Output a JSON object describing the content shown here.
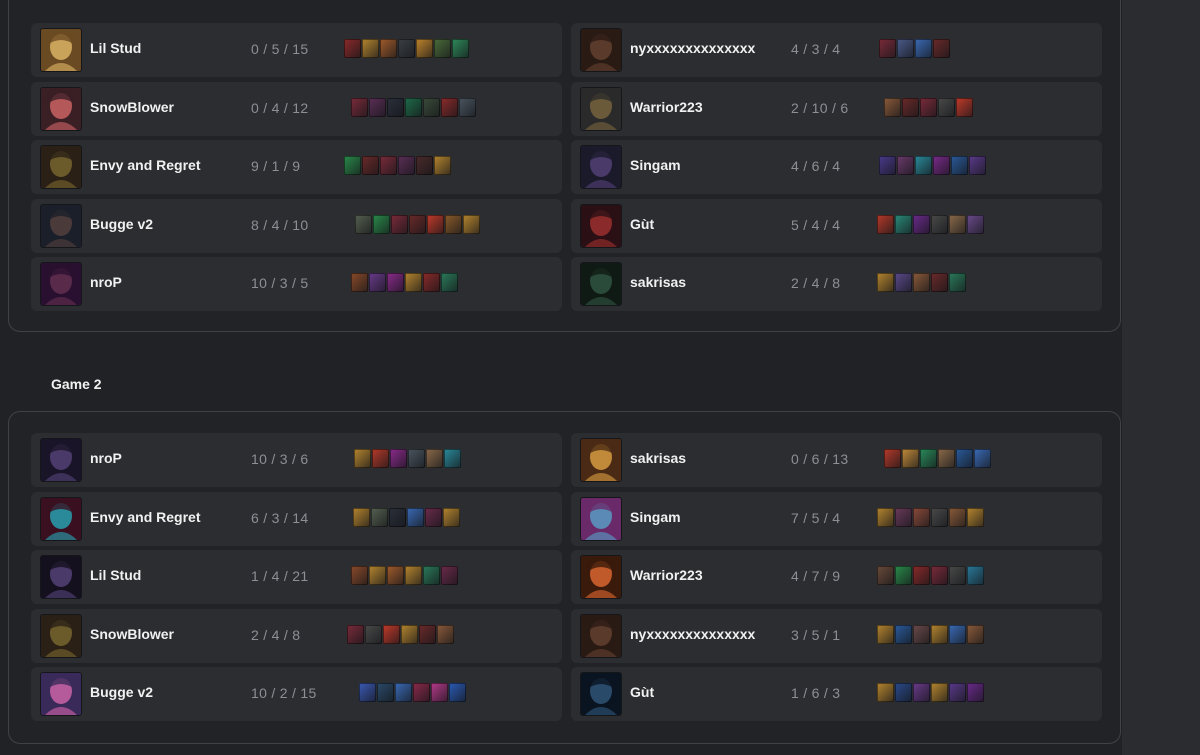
{
  "game2_label": "Game 2",
  "games": [
    {
      "left": [
        {
          "name": "Lil Stud",
          "kda": "0 / 5 / 15",
          "avatar": [
            "#caa35a",
            "#6a4a22"
          ],
          "items": [
            "#8b2a2a",
            "#b5852f",
            "#a05b2c",
            "#3b3f44",
            "#c0852c",
            "#4a6b3a",
            "#2e8a5a"
          ]
        },
        {
          "name": "SnowBlower",
          "kda": "0 / 4 / 12",
          "avatar": [
            "#b5585a",
            "#3a1f24"
          ],
          "items": [
            "#7a2b3a",
            "#5a2e55",
            "#2a2f3a",
            "#1f6b4a",
            "#3a4a3a",
            "#8a2b2b",
            "#4a5560"
          ]
        },
        {
          "name": "Envy and Regret",
          "kda": "9 / 1 / 9",
          "avatar": [
            "#6b5a2a",
            "#2a2016"
          ],
          "items": [
            "#2a8a4a",
            "#6a2a2a",
            "#7a2b3a",
            "#5a2e55",
            "#4a2a2a",
            "#b5852f"
          ]
        },
        {
          "name": "Bugge v2",
          "kda": "8 / 4 / 10",
          "avatar": [
            "#4a3a3a",
            "#1a1f2a"
          ],
          "items": [
            "#556050",
            "#2a8a4a",
            "#7a2b3a",
            "#6a2a2a",
            "#c03a2a",
            "#8a5a2a",
            "#b5852f"
          ]
        },
        {
          "name": "nroP",
          "kda": "10 / 3 / 5",
          "avatar": [
            "#5a2a4a",
            "#2a1030"
          ],
          "items": [
            "#8a4a2a",
            "#6a3a8a",
            "#8a2a8a",
            "#b5852f",
            "#8a2a2a",
            "#2a7a5a"
          ]
        }
      ],
      "right": [
        {
          "name": "nyxxxxxxxxxxxxxx",
          "kda": "4 / 3 / 4",
          "avatar": [
            "#5a3a2a",
            "#2a1a14"
          ],
          "items": [
            "#7a2b3a",
            "#4a5a8a",
            "#3a6ab5",
            "#6a2a2a"
          ]
        },
        {
          "name": "Warrior223",
          "kda": "2 / 10 / 6",
          "avatar": [
            "#6a5a3a",
            "#2a2a2a"
          ],
          "items": [
            "#8a5a3a",
            "#6a2a2a",
            "#7a2b3a",
            "#4a4a4a",
            "#c03a2a"
          ]
        },
        {
          "name": "Singam",
          "kda": "4 / 6 / 4",
          "avatar": [
            "#4a3a6a",
            "#1a1a2a"
          ],
          "items": [
            "#4a3a8a",
            "#6a3a6a",
            "#2a8a9a",
            "#7a2a8a",
            "#2a5a9a",
            "#5a3a8a"
          ]
        },
        {
          "name": "Gùt",
          "kda": "5 / 4 / 4",
          "avatar": [
            "#8a2a2a",
            "#2a1014"
          ],
          "items": [
            "#b53a2a",
            "#2a8a7a",
            "#6a2a8a",
            "#4a4a4a",
            "#8a6a4a",
            "#6a4a8a"
          ]
        },
        {
          "name": "sakrisas",
          "kda": "2 / 4 / 8",
          "avatar": [
            "#2a4a3a",
            "#101a14"
          ],
          "items": [
            "#b5852f",
            "#5a4a8a",
            "#8a5a3a",
            "#6a2a2a",
            "#2a7a5a"
          ]
        }
      ]
    },
    {
      "left": [
        {
          "name": "nroP",
          "kda": "10 / 3 / 6",
          "avatar": [
            "#4a3a6a",
            "#1a1428"
          ],
          "items": [
            "#b5852f",
            "#b53a2a",
            "#8a2a8a",
            "#4a5560",
            "#8a6a4a",
            "#2a8a9a"
          ]
        },
        {
          "name": "Envy and Regret",
          "kda": "6 / 3 / 14",
          "avatar": [
            "#2a8a9a",
            "#3a1020"
          ],
          "items": [
            "#b5852f",
            "#556050",
            "#2a2f3a",
            "#3a6ab5",
            "#6a2a4a",
            "#b5852f"
          ]
        },
        {
          "name": "Lil Stud",
          "kda": "1 / 4 / 21",
          "avatar": [
            "#4a3a6a",
            "#14101e"
          ],
          "items": [
            "#8a4a2a",
            "#b5852f",
            "#a05b2c",
            "#b5852f",
            "#2a7a5a",
            "#6a2a4a"
          ]
        },
        {
          "name": "SnowBlower",
          "kda": "2 / 4 / 8",
          "avatar": [
            "#6b5a2a",
            "#2a2016"
          ],
          "items": [
            "#7a2b3a",
            "#4a4a4a",
            "#c03a2a",
            "#b5852f",
            "#6a2a2a",
            "#8a5a3a"
          ]
        },
        {
          "name": "Bugge v2",
          "kda": "10 / 2 / 15",
          "avatar": [
            "#b55a9a",
            "#3a2a5a"
          ],
          "items": [
            "#3a5ab5",
            "#2a4a6a",
            "#3a6ab5",
            "#8a2a4a",
            "#b53a8a",
            "#2a5ab5"
          ]
        }
      ],
      "right": [
        {
          "name": "sakrisas",
          "kda": "0 / 6 / 13",
          "avatar": [
            "#c08a3a",
            "#4a2a14"
          ],
          "items": [
            "#b53a2a",
            "#c08a3a",
            "#2a8a5a",
            "#8a6a4a",
            "#2a5a9a",
            "#3a6ab5"
          ]
        },
        {
          "name": "Singam",
          "kda": "7 / 5 / 4",
          "avatar": [
            "#5a8ab5",
            "#6a2a6a"
          ],
          "items": [
            "#b5852f",
            "#6a3a5a",
            "#8a4a3a",
            "#4a4a4a",
            "#8a5a3a",
            "#b5852f"
          ]
        },
        {
          "name": "Warrior223",
          "kda": "4 / 7 / 9",
          "avatar": [
            "#c05a2a",
            "#3a1a0a"
          ],
          "items": [
            "#6a4a3a",
            "#2a8a4a",
            "#8a2a2a",
            "#7a2b3a",
            "#4a4a4a",
            "#2a7a9a"
          ]
        },
        {
          "name": "nyxxxxxxxxxxxxxx",
          "kda": "3 / 5 / 1",
          "avatar": [
            "#5a3a2a",
            "#2a1a14"
          ],
          "items": [
            "#b5852f",
            "#2a5a9a",
            "#6a4a4a",
            "#b5852f",
            "#3a6ab5",
            "#8a5a3a"
          ]
        },
        {
          "name": "Gùt",
          "kda": "1 / 6 / 3",
          "avatar": [
            "#2a4a6a",
            "#0a1420"
          ],
          "items": [
            "#b5852f",
            "#2a4a8a",
            "#6a3a8a",
            "#b5852f",
            "#5a3a8a",
            "#6a2a8a"
          ]
        }
      ]
    }
  ]
}
